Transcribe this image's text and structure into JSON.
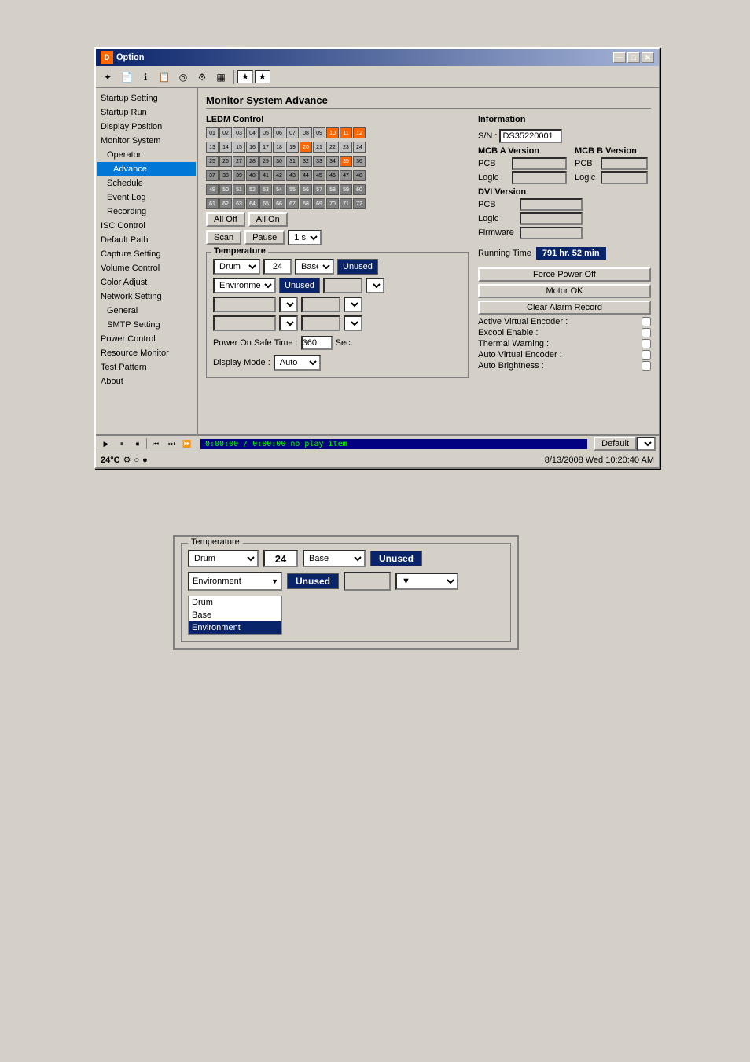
{
  "window": {
    "title": "Option",
    "min_btn": "─",
    "max_btn": "□",
    "close_btn": "✕"
  },
  "toolbar": {
    "buttons": [
      {
        "name": "star-icon",
        "icon": "✦"
      },
      {
        "name": "document-icon",
        "icon": "📄"
      },
      {
        "name": "info-icon",
        "icon": "ℹ"
      },
      {
        "name": "document2-icon",
        "icon": "📋"
      },
      {
        "name": "circle-icon",
        "icon": "◎"
      },
      {
        "name": "settings-icon",
        "icon": "⚙"
      },
      {
        "name": "grid-icon",
        "icon": "▦"
      }
    ],
    "star_buttons": [
      "★",
      "★"
    ]
  },
  "sidebar": {
    "items": [
      {
        "label": "Startup Setting",
        "indent": 0
      },
      {
        "label": "Startup Run",
        "indent": 0
      },
      {
        "label": "Display Position",
        "indent": 0
      },
      {
        "label": "Monitor System",
        "indent": 0
      },
      {
        "label": "Operator",
        "indent": 1
      },
      {
        "label": "Advance",
        "indent": 1,
        "selected": true
      },
      {
        "label": "Schedule",
        "indent": 1
      },
      {
        "label": "Event Log",
        "indent": 1
      },
      {
        "label": "Recording",
        "indent": 1
      },
      {
        "label": "ISC Control",
        "indent": 0
      },
      {
        "label": "Default Path",
        "indent": 0
      },
      {
        "label": "Capture Setting",
        "indent": 0
      },
      {
        "label": "Volume Control",
        "indent": 0
      },
      {
        "label": "Color Adjust",
        "indent": 0
      },
      {
        "label": "Network Setting",
        "indent": 0
      },
      {
        "label": "General",
        "indent": 1
      },
      {
        "label": "SMTP Setting",
        "indent": 1
      },
      {
        "label": "Power Control",
        "indent": 0
      },
      {
        "label": "Resource Monitor",
        "indent": 0
      },
      {
        "label": "Test Pattern",
        "indent": 0
      },
      {
        "label": "About",
        "indent": 0
      }
    ]
  },
  "content": {
    "title": "Monitor System Advance",
    "ledm": {
      "title": "LEDM Control",
      "rows": [
        [
          1,
          2,
          3,
          4,
          5,
          6,
          7,
          8,
          9,
          10,
          11,
          12
        ],
        [
          13,
          14,
          15,
          16,
          17,
          18,
          19,
          20,
          21,
          22,
          23,
          24
        ],
        [
          25,
          26,
          27,
          28,
          29,
          30,
          31,
          32,
          33,
          34,
          35,
          36
        ],
        [
          37,
          38,
          39,
          40,
          41,
          42,
          43,
          44,
          45,
          46,
          47,
          48
        ],
        [
          49,
          50,
          51,
          52,
          53,
          54,
          55,
          56,
          57,
          58,
          59,
          60
        ],
        [
          61,
          62,
          63,
          64,
          65,
          66,
          67,
          68,
          69,
          70,
          71,
          72
        ]
      ],
      "all_off_btn": "All Off",
      "all_on_btn": "All On",
      "scan_btn": "Scan",
      "pause_btn": "Pause",
      "interval_value": "1 s"
    },
    "temperature": {
      "title": "Temperature",
      "row1": {
        "sensor1_label": "Drum",
        "sensor1_value": "24",
        "sensor2_label": "Base",
        "sensor2_unused": "Unused"
      },
      "row2": {
        "sensor1_label": "Environment",
        "sensor1_unused": "Unused"
      },
      "power_on": {
        "label": "Power On Safe Time :",
        "value": "360",
        "unit": "Sec."
      },
      "display_mode": {
        "label": "Display Mode :",
        "value": "Auto"
      }
    },
    "information": {
      "title": "Information",
      "sn_label": "S/N :",
      "sn_value": "DS35220001",
      "mcb_a_label": "MCB A Version",
      "pcb_label": "PCB",
      "logic_label": "Logic",
      "dvi_label": "DVI Version",
      "pcb2_label": "PCB",
      "logic2_label": "Logic",
      "firmware_label": "Firmware",
      "mcb_b_label": "MCB B Version",
      "pcb3_label": "PCB",
      "logic3_label": "Logic",
      "pcb4_label": "PCB",
      "logic4_label": "Logic",
      "running_time_label": "Running Time",
      "running_time_value": "791 hr. 52 min",
      "force_power_off_btn": "Force Power Off",
      "motor_ok_btn": "Motor OK",
      "clear_alarm_btn": "Clear Alarm Record",
      "active_virtual_encoder": "Active Virtual Encoder :",
      "excool_enable": "Excool Enable :",
      "thermal_warning": "Thermal Warning :",
      "auto_virtual_encoder": "Auto Virtual Encoder :",
      "auto_brightness": "Auto Brightness :"
    }
  },
  "status_bar": {
    "transport": [
      "▶",
      "⏸",
      "⏹",
      "⏮",
      "⏭",
      "⏩"
    ],
    "time_display": "0:00:00 / 0:00:00  no play item",
    "default_btn": "Default"
  },
  "bottom_bar": {
    "temp": "24°C",
    "icons": [
      "⚙",
      "○"
    ],
    "datetime": "8/13/2008 Wed 10:20:40 AM"
  },
  "zoom_temperature": {
    "title": "Temperature",
    "row1": {
      "sensor1_label": "Drum",
      "sensor1_value": "24",
      "sensor2_label": "Base",
      "sensor2_unused": "Unused"
    },
    "row2": {
      "sensor_label": "Environment",
      "sensor_unused": "Unused"
    },
    "dropdown_items": [
      "Drum",
      "Base",
      "Environment"
    ],
    "selected": "Environment"
  }
}
